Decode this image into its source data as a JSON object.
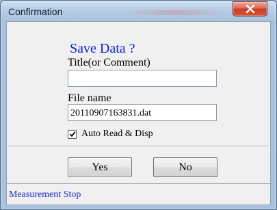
{
  "window": {
    "title": "Confirmation"
  },
  "dialog": {
    "heading": "Save Data ?",
    "title_label": "Title(or Comment)",
    "title_value": "",
    "filename_label": "File name",
    "filename_value": "20110907163831.dat",
    "auto_read_label": "Auto Read & Disp",
    "auto_read_checked": true,
    "yes_label": "Yes",
    "no_label": "No"
  },
  "status": {
    "text": "Measurement Stop"
  },
  "icons": {
    "close": "close-icon",
    "check": "check-icon"
  },
  "colors": {
    "heading": "#0b1fd6",
    "status_text": "#1a2fc8",
    "close_button": "#d9533b"
  }
}
